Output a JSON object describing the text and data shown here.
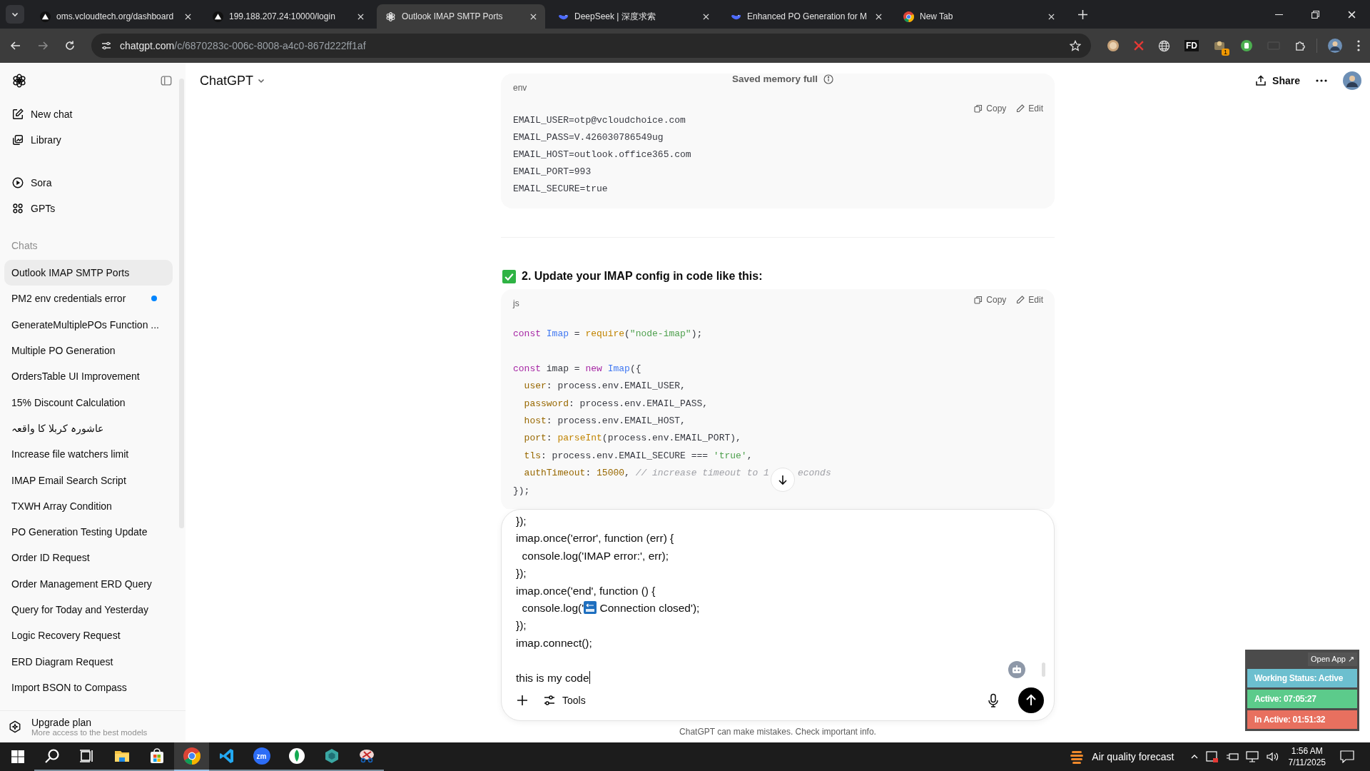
{
  "browser": {
    "tabs": [
      {
        "title": "oms.vcloudtech.org/dashboard",
        "selected": false
      },
      {
        "title": "199.188.207.24:10000/login",
        "selected": false
      },
      {
        "title": "Outlook IMAP SMTP Ports",
        "selected": true
      },
      {
        "title": "DeepSeek | 深度求索",
        "selected": false
      },
      {
        "title": "Enhanced PO Generation for M",
        "selected": false
      },
      {
        "title": "New Tab",
        "selected": false
      }
    ],
    "address": {
      "host": "chatgpt.com",
      "path": "/c/6870283c-006c-8008-a4c0-867d222ff1af"
    },
    "fd_label": "FD",
    "extension_badge": "1"
  },
  "sidebar": {
    "nav": [
      {
        "label": "New chat"
      },
      {
        "label": "Library"
      }
    ],
    "apps": [
      {
        "label": "Sora"
      },
      {
        "label": "GPTs"
      }
    ],
    "section_title": "Chats",
    "chats": [
      {
        "label": "Outlook IMAP SMTP Ports",
        "selected": true,
        "unread": false
      },
      {
        "label": "PM2 env credentials error",
        "selected": false,
        "unread": true
      },
      {
        "label": "GenerateMultiplePOs Function ...",
        "selected": false,
        "unread": false
      },
      {
        "label": "Multiple PO Generation",
        "selected": false,
        "unread": false
      },
      {
        "label": "OrdersTable UI Improvement",
        "selected": false,
        "unread": false
      },
      {
        "label": "15% Discount Calculation",
        "selected": false,
        "unread": false
      },
      {
        "label": "عاشورہ کربلا کا واقعہ",
        "selected": false,
        "unread": false
      },
      {
        "label": "Increase file watchers limit",
        "selected": false,
        "unread": false
      },
      {
        "label": "IMAP Email Search Script",
        "selected": false,
        "unread": false
      },
      {
        "label": "TXWH Array Condition",
        "selected": false,
        "unread": false
      },
      {
        "label": "PO Generation Testing Update",
        "selected": false,
        "unread": false
      },
      {
        "label": "Order ID Request",
        "selected": false,
        "unread": false
      },
      {
        "label": "Order Management ERD Query",
        "selected": false,
        "unread": false
      },
      {
        "label": "Query for Today and Yesterday",
        "selected": false,
        "unread": false
      },
      {
        "label": "Logic Recovery Request",
        "selected": false,
        "unread": false
      },
      {
        "label": "ERD Diagram Request",
        "selected": false,
        "unread": false
      },
      {
        "label": "Import BSON to Compass",
        "selected": false,
        "unread": false
      }
    ],
    "upgrade": {
      "title": "Upgrade plan",
      "subtitle": "More access to the best models"
    }
  },
  "header": {
    "model": "ChatGPT",
    "notice": "Saved memory full",
    "share": "Share"
  },
  "env_block": {
    "language": "env",
    "actions": [
      "Copy",
      "Edit"
    ],
    "lines": [
      "EMAIL_USER=otp@vcloudchoice.com",
      "EMAIL_PASS=V.426030786549ug",
      "EMAIL_HOST=outlook.office365.com",
      "EMAIL_PORT=993",
      "EMAIL_SECURE=true"
    ]
  },
  "heading": "2. Update your IMAP config in code like this:",
  "js_block": {
    "language": "js",
    "actions": [
      "Copy",
      "Edit"
    ],
    "lines": [
      {
        "gap_before": false,
        "tokens": [
          {
            "t": "const ",
            "color": "#a626a4"
          },
          {
            "t": "Imap",
            "color": "#4078f2"
          },
          {
            "t": " = "
          },
          {
            "t": "require",
            "color": "#c18401"
          },
          {
            "t": "("
          },
          {
            "t": "\"node-imap\"",
            "color": "#50a14f"
          },
          {
            "t": ");"
          }
        ]
      },
      {
        "gap_before": true,
        "tokens": [
          {
            "t": "const",
            "color": "#a626a4"
          },
          {
            "t": " imap = "
          },
          {
            "t": "new ",
            "color": "#a626a4"
          },
          {
            "t": "Imap",
            "color": "#4078f2"
          },
          {
            "t": "({"
          }
        ]
      },
      {
        "gap_before": false,
        "tokens": [
          {
            "t": "  user",
            "color": "#986801"
          },
          {
            "t": ": process.env.EMAIL_USER,"
          }
        ]
      },
      {
        "gap_before": false,
        "tokens": [
          {
            "t": "  password",
            "color": "#986801"
          },
          {
            "t": ": process.env.EMAIL_PASS,"
          }
        ]
      },
      {
        "gap_before": false,
        "tokens": [
          {
            "t": "  host",
            "color": "#986801"
          },
          {
            "t": ": process.env.EMAIL_HOST,"
          }
        ]
      },
      {
        "gap_before": false,
        "tokens": [
          {
            "t": "  port",
            "color": "#986801"
          },
          {
            "t": ": "
          },
          {
            "t": "parseInt",
            "color": "#c18401"
          },
          {
            "t": "(process.env.EMAIL_PORT),"
          }
        ]
      },
      {
        "gap_before": false,
        "tokens": [
          {
            "t": "  tls",
            "color": "#986801"
          },
          {
            "t": ": process.env.EMAIL_SECURE === "
          },
          {
            "t": "'true'",
            "color": "#50a14f"
          },
          {
            "t": ","
          }
        ]
      },
      {
        "gap_before": false,
        "tokens": [
          {
            "t": "  authTimeout",
            "color": "#986801"
          },
          {
            "t": ": "
          },
          {
            "t": "15000",
            "color": "#986801"
          },
          {
            "t": ", "
          },
          {
            "t": "// increase timeout to 1",
            "color": "#a0a1a7",
            "italic": true
          }
        ],
        "tail": {
          "t": "econds",
          "color": "#a0a1a7",
          "italic": true
        }
      },
      {
        "gap_before": false,
        "tokens": [
          {
            "t": "});"
          }
        ]
      }
    ]
  },
  "composer": {
    "value": [
      {
        "kind": "text",
        "t": "});\nimap.once('error', function (err) {\n  console.log('IMAP error:', err);\n});\nimap.once('end', function () {\n  console.log('"
      },
      {
        "kind": "end-emoji"
      },
      {
        "kind": "text",
        "t": " Connection closed');\n});\nimap.connect();\n\nthis is my code"
      }
    ],
    "tools": "Tools"
  },
  "disclaimer": "ChatGPT can make mistakes. Check important info.",
  "widget": {
    "open": "Open App ↗",
    "rows": [
      {
        "text": "Working Status: Active",
        "color": "#6cbfcf"
      },
      {
        "text": "Active: 07:05:27",
        "color": "#5ccb8b"
      },
      {
        "text": "In Active: 01:51:32",
        "color": "#e8705f"
      }
    ]
  },
  "taskbar": {
    "apps": [
      {
        "active": false
      },
      {
        "active": false
      },
      {
        "active": false
      },
      {
        "active": false
      },
      {
        "active": true
      },
      {
        "active": false
      },
      {
        "label": "zm",
        "active": false
      },
      {
        "active": false
      },
      {
        "active": false
      },
      {
        "active": false
      }
    ],
    "weather": "Air quality forecast",
    "time": "1:56 AM",
    "date": "7/11/2025"
  }
}
